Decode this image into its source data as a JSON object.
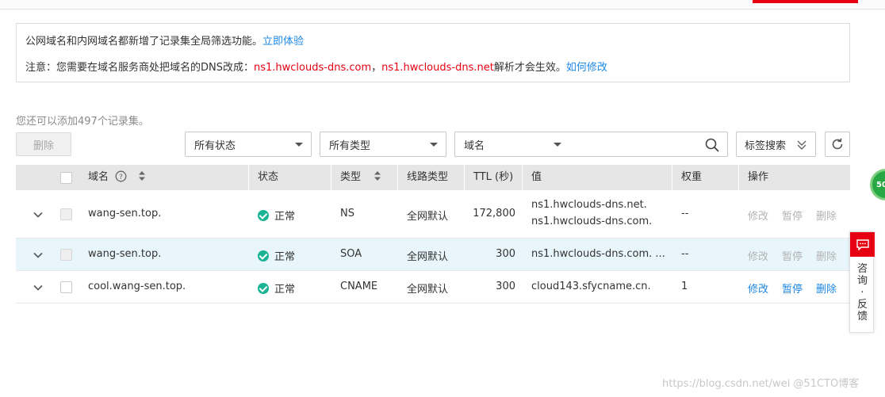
{
  "notice": {
    "line1_text": "公网域名和内网域名都新增了记录集全局筛选功能。",
    "line1_link": "立即体验",
    "line2_prefix": "注意：您需要在域名服务商处把域名的DNS改成：",
    "ns1": "ns1.hwclouds-dns.com",
    "separator": "，",
    "ns2": "ns1.hwclouds-dns.net",
    "line2_suffix": "解析才会生效。",
    "line2_link": "如何修改"
  },
  "toolbar": {
    "quota_text": "您还可以添加497个记录集。",
    "delete_label": "删除",
    "status_filter": "所有状态",
    "type_filter": "所有类型",
    "field_filter": "域名",
    "search_value": "",
    "tag_search_label": "标签搜索"
  },
  "table": {
    "headers": {
      "domain": "域名",
      "status": "状态",
      "type": "类型",
      "line_type": "线路类型",
      "ttl": "TTL (秒)",
      "value": "值",
      "weight": "权重",
      "actions": "操作"
    },
    "rows": [
      {
        "domain": "wang-sen.top.",
        "status": "正常",
        "type": "NS",
        "line": "全网默认",
        "ttl": "172,800",
        "value_line1": "ns1.hwclouds-dns.net.",
        "value_line2": "ns1.hwclouds-dns.com.",
        "weight": "--",
        "modify": "修改",
        "pause": "暂停",
        "delete": "删除",
        "actions_enabled": false,
        "highlighted": false
      },
      {
        "domain": "wang-sen.top.",
        "status": "正常",
        "type": "SOA",
        "line": "全网默认",
        "ttl": "300",
        "value_line1": "ns1.hwclouds-dns.com. ...",
        "value_line2": "",
        "weight": "--",
        "modify": "修改",
        "pause": "暂停",
        "delete": "删除",
        "actions_enabled": false,
        "highlighted": true
      },
      {
        "domain": "cool.wang-sen.top.",
        "status": "正常",
        "type": "CNAME",
        "line": "全网默认",
        "ttl": "300",
        "value_line1": "cloud143.sfycname.cn.",
        "value_line2": "",
        "weight": "1",
        "modify": "修改",
        "pause": "暂停",
        "delete": "删除",
        "actions_enabled": true,
        "highlighted": false
      }
    ]
  },
  "float_badge": "50",
  "feedback": {
    "text": "咨询·反馈"
  },
  "watermark": "https://blog.csdn.net/wei @51CTO博客",
  "colors": {
    "accent": "#1e88e5",
    "danger": "#e60012",
    "success": "#1ab394"
  }
}
